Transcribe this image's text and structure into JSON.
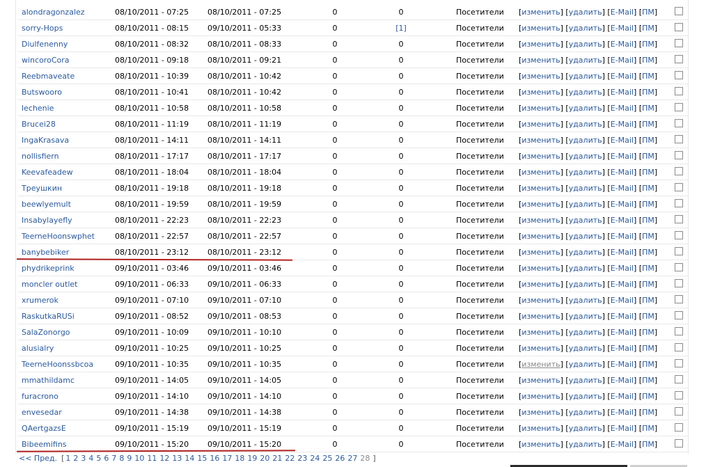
{
  "columns": {
    "group": "Посетители",
    "actions": {
      "edit": "изменить",
      "delete": "удалить",
      "email": "E-Mail",
      "pm": "ПМ",
      "open": "[",
      "sep": "] [",
      "close": "]"
    }
  },
  "rows": [
    {
      "name": "alondragonzalez",
      "reg": "08/10/2011 - 07:25",
      "last": "08/10/2011 - 07:25",
      "posts": "0",
      "other": "0"
    },
    {
      "name": "sorry-Hops",
      "reg": "08/10/2011 - 08:15",
      "last": "09/10/2011 - 05:33",
      "posts": "0",
      "other": "[1]",
      "other_link": true
    },
    {
      "name": "Diulfenenny",
      "reg": "08/10/2011 - 08:32",
      "last": "08/10/2011 - 08:33",
      "posts": "0",
      "other": "0"
    },
    {
      "name": "wincoroCora",
      "reg": "08/10/2011 - 09:18",
      "last": "08/10/2011 - 09:21",
      "posts": "0",
      "other": "0"
    },
    {
      "name": "Reebmaveate",
      "reg": "08/10/2011 - 10:39",
      "last": "08/10/2011 - 10:42",
      "posts": "0",
      "other": "0"
    },
    {
      "name": "Butswooro",
      "reg": "08/10/2011 - 10:41",
      "last": "08/10/2011 - 10:42",
      "posts": "0",
      "other": "0"
    },
    {
      "name": "lechenie",
      "reg": "08/10/2011 - 10:58",
      "last": "08/10/2011 - 10:58",
      "posts": "0",
      "other": "0"
    },
    {
      "name": "Brucei28",
      "reg": "08/10/2011 - 11:19",
      "last": "08/10/2011 - 11:19",
      "posts": "0",
      "other": "0"
    },
    {
      "name": "IngaKrasava",
      "reg": "08/10/2011 - 14:11",
      "last": "08/10/2011 - 14:11",
      "posts": "0",
      "other": "0"
    },
    {
      "name": "nollisfiern",
      "reg": "08/10/2011 - 17:17",
      "last": "08/10/2011 - 17:17",
      "posts": "0",
      "other": "0"
    },
    {
      "name": "Keevafeadew",
      "reg": "08/10/2011 - 18:04",
      "last": "08/10/2011 - 18:04",
      "posts": "0",
      "other": "0"
    },
    {
      "name": "Треушкин",
      "reg": "08/10/2011 - 19:18",
      "last": "08/10/2011 - 19:18",
      "posts": "0",
      "other": "0"
    },
    {
      "name": "beewlyemult",
      "reg": "08/10/2011 - 19:59",
      "last": "08/10/2011 - 19:59",
      "posts": "0",
      "other": "0"
    },
    {
      "name": "Insabylayefly",
      "reg": "08/10/2011 - 22:23",
      "last": "08/10/2011 - 22:23",
      "posts": "0",
      "other": "0"
    },
    {
      "name": "TeerneHoonswphet",
      "reg": "08/10/2011 - 22:57",
      "last": "08/10/2011 - 22:57",
      "posts": "0",
      "other": "0"
    },
    {
      "name": "banybebiker",
      "reg": "08/10/2011 - 23:12",
      "last": "08/10/2011 - 23:12",
      "posts": "0",
      "other": "0"
    },
    {
      "name": "phydrikeprink",
      "reg": "09/10/2011 - 03:46",
      "last": "09/10/2011 - 03:46",
      "posts": "0",
      "other": "0"
    },
    {
      "name": "moncler outlet",
      "reg": "09/10/2011 - 06:33",
      "last": "09/10/2011 - 06:33",
      "posts": "0",
      "other": "0"
    },
    {
      "name": "xrumerok",
      "reg": "09/10/2011 - 07:10",
      "last": "09/10/2011 - 07:10",
      "posts": "0",
      "other": "0"
    },
    {
      "name": "RaskutkaRUSi",
      "reg": "09/10/2011 - 08:52",
      "last": "09/10/2011 - 08:53",
      "posts": "0",
      "other": "0"
    },
    {
      "name": "SalaZonorgo",
      "reg": "09/10/2011 - 10:09",
      "last": "09/10/2011 - 10:10",
      "posts": "0",
      "other": "0"
    },
    {
      "name": "alusialry",
      "reg": "09/10/2011 - 10:25",
      "last": "09/10/2011 - 10:25",
      "posts": "0",
      "other": "0"
    },
    {
      "name": "TeerneHoonssbcoa",
      "reg": "09/10/2011 - 10:35",
      "last": "09/10/2011 - 10:35",
      "posts": "0",
      "other": "0",
      "edit_disabled": true
    },
    {
      "name": "mmathildamc",
      "reg": "09/10/2011 - 14:05",
      "last": "09/10/2011 - 14:05",
      "posts": "0",
      "other": "0"
    },
    {
      "name": "furacrono",
      "reg": "09/10/2011 - 14:10",
      "last": "09/10/2011 - 14:10",
      "posts": "0",
      "other": "0"
    },
    {
      "name": "envesedar",
      "reg": "09/10/2011 - 14:38",
      "last": "09/10/2011 - 14:38",
      "posts": "0",
      "other": "0"
    },
    {
      "name": "QAertgazsE",
      "reg": "09/10/2011 - 15:19",
      "last": "09/10/2011 - 15:19",
      "posts": "0",
      "other": "0"
    },
    {
      "name": "Bibeemifins",
      "reg": "09/10/2011 - 15:20",
      "last": "09/10/2011 - 15:20",
      "posts": "0",
      "other": "0"
    }
  ],
  "pagination": {
    "prev": "<< Пред.",
    "open": "[",
    "close": "]",
    "pages": [
      "1",
      "2",
      "3",
      "4",
      "5",
      "6",
      "7",
      "8",
      "9",
      "10",
      "11",
      "12",
      "13",
      "14",
      "15",
      "16",
      "17",
      "18",
      "19",
      "20",
      "21",
      "22",
      "23",
      "24",
      "25",
      "26",
      "27"
    ],
    "current": "28"
  },
  "colors": {
    "link": "#2a5a9e",
    "highlight_underline": "#b22222",
    "muted": "#8a8a8a"
  }
}
